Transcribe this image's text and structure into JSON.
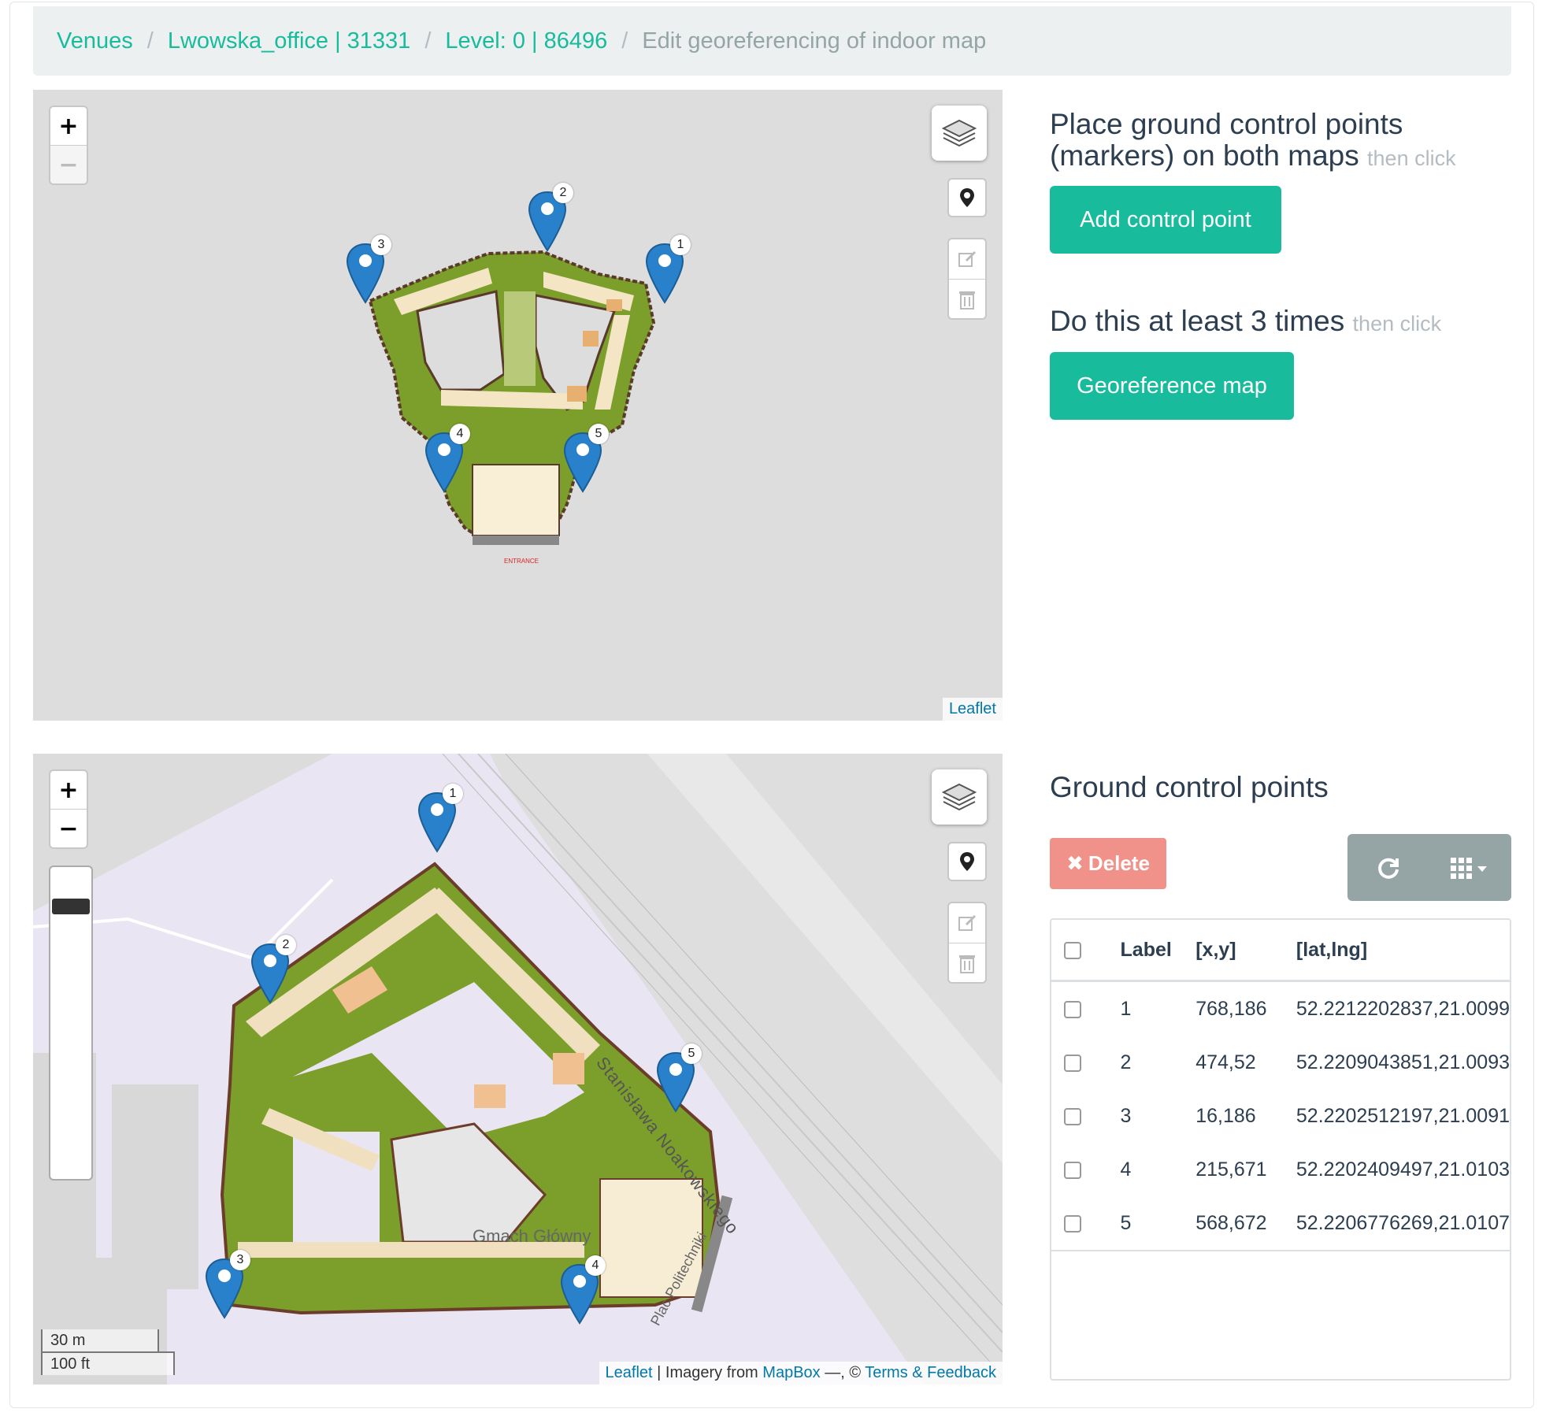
{
  "breadcrumb": {
    "venues": "Venues",
    "venue": "Lwowska_office | 31331",
    "level": "Level: 0 | 86496",
    "current": "Edit georeferencing of indoor map"
  },
  "map_top": {
    "zoom_in": "+",
    "zoom_out": "−",
    "attribution_link": "Leaflet",
    "markers": [
      "1",
      "2",
      "3",
      "4",
      "5"
    ]
  },
  "map_bottom": {
    "zoom_in": "+",
    "zoom_out": "−",
    "attribution_link": "Leaflet",
    "attribution_text": " | Imagery from ",
    "attribution_mapbox": "MapBox",
    "attribution_mid": " —, © ",
    "attribution_terms": "Terms & Feedback",
    "scale_metric": "30 m",
    "scale_imperial": "100 ft",
    "street_label": "Stanisława Noakowskiego",
    "building_label": "Gmach Główny",
    "square_label": "Plac Politechniki",
    "markers": [
      "1",
      "2",
      "3",
      "4",
      "5"
    ]
  },
  "side": {
    "instruction_1": "Place ground control points (markers) on both maps",
    "instruction_1_hint": "then click",
    "add_button": "Add control point",
    "instruction_2": "Do this at least 3 times",
    "instruction_2_hint": "then click",
    "georeference_button": "Georeference map",
    "gcp_title": "Ground control points",
    "delete_button": "Delete"
  },
  "table": {
    "headers": [
      "Label",
      "[x,y]",
      "[lat,lng]"
    ],
    "rows": [
      {
        "label": "1",
        "xy": "768,186",
        "latlng": "52.2212202837,21.0099"
      },
      {
        "label": "2",
        "xy": "474,52",
        "latlng": "52.2209043851,21.0093"
      },
      {
        "label": "3",
        "xy": "16,186",
        "latlng": "52.2202512197,21.0091"
      },
      {
        "label": "4",
        "xy": "215,671",
        "latlng": "52.2202409497,21.0103"
      },
      {
        "label": "5",
        "xy": "568,672",
        "latlng": "52.2206776269,21.0107"
      }
    ]
  },
  "colors": {
    "accent": "#18bc9c",
    "danger": "#f0928a",
    "muted": "#95a5a6",
    "marker": "#2a81cb"
  }
}
